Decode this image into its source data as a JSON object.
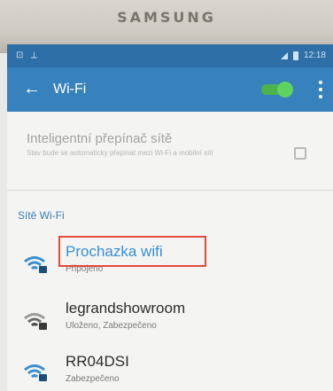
{
  "device": {
    "brand": "SAMSUNG"
  },
  "statusbar": {
    "left_icons": "⊡ ⟂",
    "time": "12:18"
  },
  "appbar": {
    "back_icon": "back-arrow-icon",
    "title": "Wi-Fi",
    "wifi_enabled": true
  },
  "intelligent": {
    "title": "Inteligentní přepínač sítě",
    "subtitle": "Stav bude se automaticky přepínat mezi Wi-Fi a mobilní sítí"
  },
  "section": {
    "label": "Sítě Wi-Fi"
  },
  "networks": [
    {
      "name": "Prochazka wifi",
      "status": "Připojeno",
      "connected": true
    },
    {
      "name": "legrandshowroom",
      "status": "Uloženo, Zabezpečeno",
      "connected": false
    },
    {
      "name": "RR04DSI",
      "status": "Zabezpečeno",
      "connected": false
    }
  ],
  "colors": {
    "appbar": "#3781bd",
    "statusbar": "#2f6fa7",
    "toggle": "#4cb34c",
    "highlight": "#e24a3b",
    "accent": "#3a8fd0"
  }
}
